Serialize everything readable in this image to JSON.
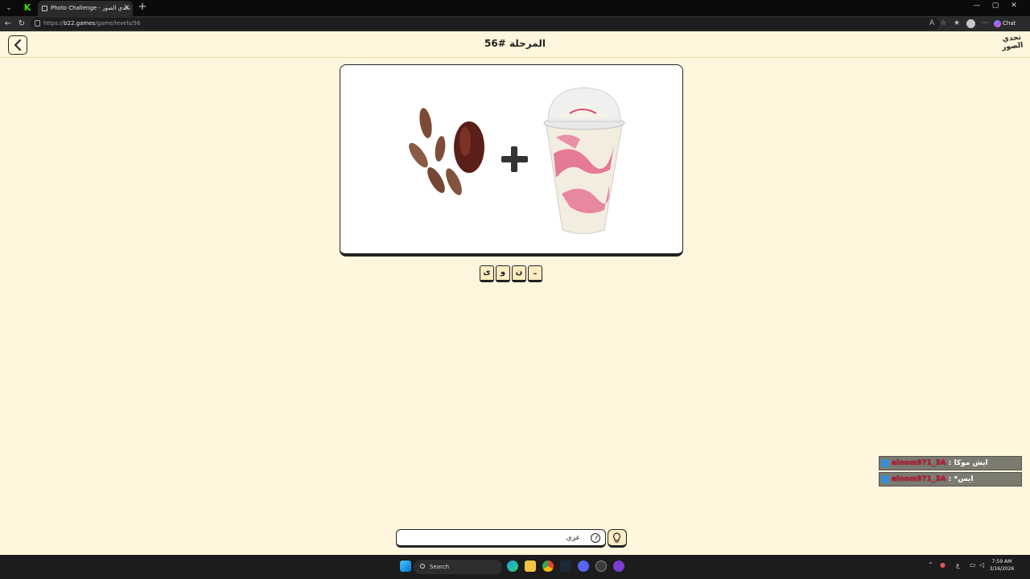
{
  "browser": {
    "tab_title": "Photo Challenge - لعبة تحدي الصور",
    "tab_close": "✕",
    "new_tab": "+",
    "url_prefix": "https://",
    "url_domain": "b22.games",
    "url_path": "/game/levels/56",
    "chat_label": "Chat",
    "window_controls": [
      "—",
      "▢",
      "✕"
    ]
  },
  "header": {
    "back_icon": "chevron-left-icon",
    "level_title": "المرحلة #56",
    "logo_text": "تحدي الصور"
  },
  "puzzle": {
    "images": [
      "dates",
      "plus",
      "milkshake-cup"
    ]
  },
  "letters": [
    "ى",
    "و",
    "ن",
    "ـ"
  ],
  "chat": [
    {
      "user": "alnom971_3A",
      "message": "ايش موكا"
    },
    {
      "user": "alnom971_3A",
      "message": "*ايس"
    }
  ],
  "answer": {
    "value": "عري",
    "hint_icon": "lightbulb-icon",
    "keyboard_icon": "keyboard-icon"
  },
  "taskbar": {
    "search_label": "Search",
    "clock_time": "7:59 AM",
    "clock_date": "3/16/2026",
    "lang": "ع"
  }
}
